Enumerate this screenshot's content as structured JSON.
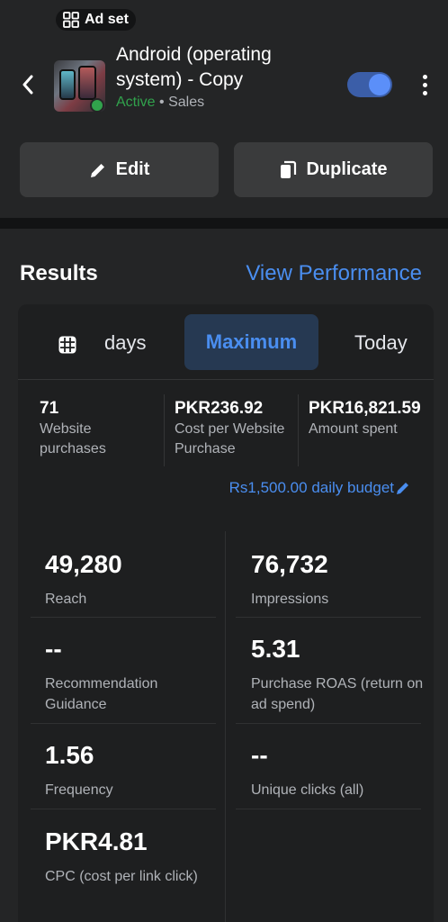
{
  "header": {
    "badge_label": "Ad set",
    "title": "Android (operating system) - Copy",
    "status": "Active",
    "separator": "•",
    "objective": "Sales",
    "toggle_on": true,
    "edit_label": "Edit",
    "duplicate_label": "Duplicate"
  },
  "results": {
    "title": "Results",
    "view_performance_label": "View Performance",
    "tabs": [
      {
        "label": "days"
      },
      {
        "label": "Maximum",
        "selected": true
      },
      {
        "label": "Today"
      }
    ],
    "summary": [
      {
        "value": "71",
        "label": "Website purchases"
      },
      {
        "value": "PKR236.92",
        "label": "Cost per Website Purchase"
      },
      {
        "value": "PKR16,821.59",
        "label": "Amount spent"
      }
    ],
    "budget_label": "Rs1,500.00 daily budget",
    "metrics": [
      {
        "value": "49,280",
        "label": "Reach"
      },
      {
        "value": "76,732",
        "label": "Impressions"
      },
      {
        "value": "--",
        "label": "Recommendation Guidance"
      },
      {
        "value": "5.31",
        "label": "Purchase ROAS (return on ad spend)"
      },
      {
        "value": "1.56",
        "label": "Frequency"
      },
      {
        "value": "--",
        "label": "Unique clicks (all)"
      },
      {
        "value": "PKR4.81",
        "label": "CPC (cost per link click)"
      }
    ]
  },
  "colors": {
    "accent": "#4a8ef0",
    "active": "#31a24c",
    "background": "#242526"
  }
}
